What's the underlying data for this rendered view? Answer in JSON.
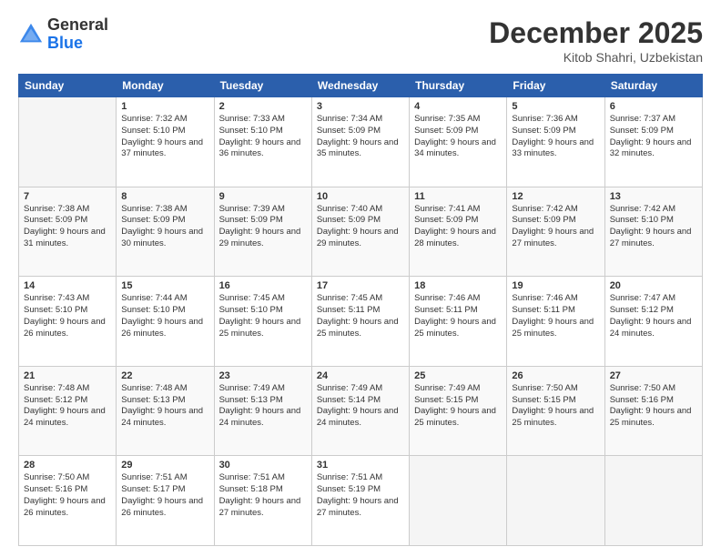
{
  "logo": {
    "general": "General",
    "blue": "Blue"
  },
  "title": "December 2025",
  "location": "Kitob Shahri, Uzbekistan",
  "weekdays": [
    "Sunday",
    "Monday",
    "Tuesday",
    "Wednesday",
    "Thursday",
    "Friday",
    "Saturday"
  ],
  "weeks": [
    [
      {
        "day": "",
        "empty": true
      },
      {
        "day": "1",
        "sunrise": "Sunrise: 7:32 AM",
        "sunset": "Sunset: 5:10 PM",
        "daylight": "Daylight: 9 hours and 37 minutes."
      },
      {
        "day": "2",
        "sunrise": "Sunrise: 7:33 AM",
        "sunset": "Sunset: 5:10 PM",
        "daylight": "Daylight: 9 hours and 36 minutes."
      },
      {
        "day": "3",
        "sunrise": "Sunrise: 7:34 AM",
        "sunset": "Sunset: 5:09 PM",
        "daylight": "Daylight: 9 hours and 35 minutes."
      },
      {
        "day": "4",
        "sunrise": "Sunrise: 7:35 AM",
        "sunset": "Sunset: 5:09 PM",
        "daylight": "Daylight: 9 hours and 34 minutes."
      },
      {
        "day": "5",
        "sunrise": "Sunrise: 7:36 AM",
        "sunset": "Sunset: 5:09 PM",
        "daylight": "Daylight: 9 hours and 33 minutes."
      },
      {
        "day": "6",
        "sunrise": "Sunrise: 7:37 AM",
        "sunset": "Sunset: 5:09 PM",
        "daylight": "Daylight: 9 hours and 32 minutes."
      }
    ],
    [
      {
        "day": "7",
        "sunrise": "Sunrise: 7:38 AM",
        "sunset": "Sunset: 5:09 PM",
        "daylight": "Daylight: 9 hours and 31 minutes."
      },
      {
        "day": "8",
        "sunrise": "Sunrise: 7:38 AM",
        "sunset": "Sunset: 5:09 PM",
        "daylight": "Daylight: 9 hours and 30 minutes."
      },
      {
        "day": "9",
        "sunrise": "Sunrise: 7:39 AM",
        "sunset": "Sunset: 5:09 PM",
        "daylight": "Daylight: 9 hours and 29 minutes."
      },
      {
        "day": "10",
        "sunrise": "Sunrise: 7:40 AM",
        "sunset": "Sunset: 5:09 PM",
        "daylight": "Daylight: 9 hours and 29 minutes."
      },
      {
        "day": "11",
        "sunrise": "Sunrise: 7:41 AM",
        "sunset": "Sunset: 5:09 PM",
        "daylight": "Daylight: 9 hours and 28 minutes."
      },
      {
        "day": "12",
        "sunrise": "Sunrise: 7:42 AM",
        "sunset": "Sunset: 5:09 PM",
        "daylight": "Daylight: 9 hours and 27 minutes."
      },
      {
        "day": "13",
        "sunrise": "Sunrise: 7:42 AM",
        "sunset": "Sunset: 5:10 PM",
        "daylight": "Daylight: 9 hours and 27 minutes."
      }
    ],
    [
      {
        "day": "14",
        "sunrise": "Sunrise: 7:43 AM",
        "sunset": "Sunset: 5:10 PM",
        "daylight": "Daylight: 9 hours and 26 minutes."
      },
      {
        "day": "15",
        "sunrise": "Sunrise: 7:44 AM",
        "sunset": "Sunset: 5:10 PM",
        "daylight": "Daylight: 9 hours and 26 minutes."
      },
      {
        "day": "16",
        "sunrise": "Sunrise: 7:45 AM",
        "sunset": "Sunset: 5:10 PM",
        "daylight": "Daylight: 9 hours and 25 minutes."
      },
      {
        "day": "17",
        "sunrise": "Sunrise: 7:45 AM",
        "sunset": "Sunset: 5:11 PM",
        "daylight": "Daylight: 9 hours and 25 minutes."
      },
      {
        "day": "18",
        "sunrise": "Sunrise: 7:46 AM",
        "sunset": "Sunset: 5:11 PM",
        "daylight": "Daylight: 9 hours and 25 minutes."
      },
      {
        "day": "19",
        "sunrise": "Sunrise: 7:46 AM",
        "sunset": "Sunset: 5:11 PM",
        "daylight": "Daylight: 9 hours and 25 minutes."
      },
      {
        "day": "20",
        "sunrise": "Sunrise: 7:47 AM",
        "sunset": "Sunset: 5:12 PM",
        "daylight": "Daylight: 9 hours and 24 minutes."
      }
    ],
    [
      {
        "day": "21",
        "sunrise": "Sunrise: 7:48 AM",
        "sunset": "Sunset: 5:12 PM",
        "daylight": "Daylight: 9 hours and 24 minutes."
      },
      {
        "day": "22",
        "sunrise": "Sunrise: 7:48 AM",
        "sunset": "Sunset: 5:13 PM",
        "daylight": "Daylight: 9 hours and 24 minutes."
      },
      {
        "day": "23",
        "sunrise": "Sunrise: 7:49 AM",
        "sunset": "Sunset: 5:13 PM",
        "daylight": "Daylight: 9 hours and 24 minutes."
      },
      {
        "day": "24",
        "sunrise": "Sunrise: 7:49 AM",
        "sunset": "Sunset: 5:14 PM",
        "daylight": "Daylight: 9 hours and 24 minutes."
      },
      {
        "day": "25",
        "sunrise": "Sunrise: 7:49 AM",
        "sunset": "Sunset: 5:15 PM",
        "daylight": "Daylight: 9 hours and 25 minutes."
      },
      {
        "day": "26",
        "sunrise": "Sunrise: 7:50 AM",
        "sunset": "Sunset: 5:15 PM",
        "daylight": "Daylight: 9 hours and 25 minutes."
      },
      {
        "day": "27",
        "sunrise": "Sunrise: 7:50 AM",
        "sunset": "Sunset: 5:16 PM",
        "daylight": "Daylight: 9 hours and 25 minutes."
      }
    ],
    [
      {
        "day": "28",
        "sunrise": "Sunrise: 7:50 AM",
        "sunset": "Sunset: 5:16 PM",
        "daylight": "Daylight: 9 hours and 26 minutes."
      },
      {
        "day": "29",
        "sunrise": "Sunrise: 7:51 AM",
        "sunset": "Sunset: 5:17 PM",
        "daylight": "Daylight: 9 hours and 26 minutes."
      },
      {
        "day": "30",
        "sunrise": "Sunrise: 7:51 AM",
        "sunset": "Sunset: 5:18 PM",
        "daylight": "Daylight: 9 hours and 27 minutes."
      },
      {
        "day": "31",
        "sunrise": "Sunrise: 7:51 AM",
        "sunset": "Sunset: 5:19 PM",
        "daylight": "Daylight: 9 hours and 27 minutes."
      },
      {
        "day": "",
        "empty": true
      },
      {
        "day": "",
        "empty": true
      },
      {
        "day": "",
        "empty": true
      }
    ]
  ]
}
